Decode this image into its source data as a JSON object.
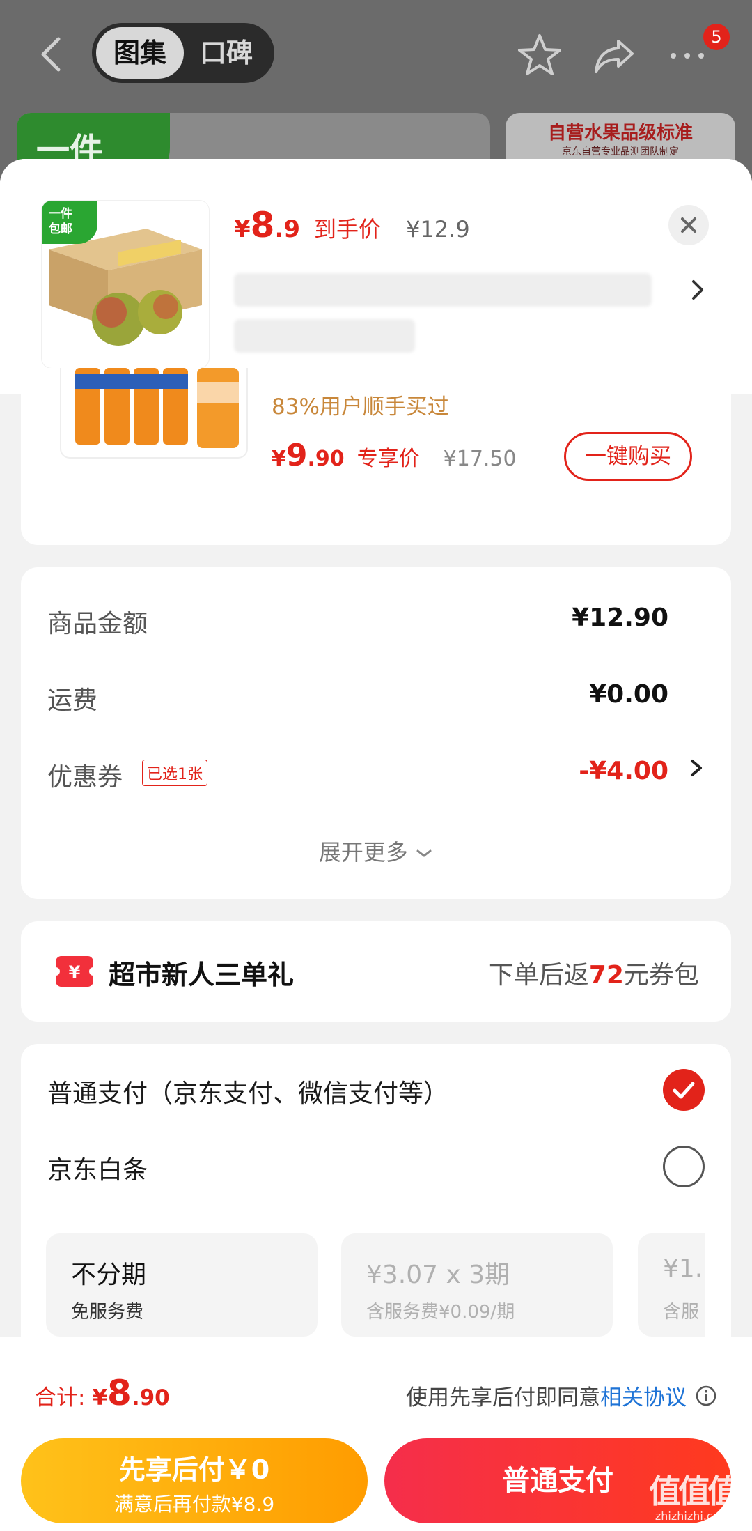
{
  "nav": {
    "tabs": [
      "图集",
      "口碑"
    ],
    "badge_count": "5"
  },
  "backdrop": {
    "promo_left": "一件",
    "promo_right_title": "自营水果品级标准",
    "promo_right_sub": "京东自营专业品测团队制定"
  },
  "product": {
    "thumb_tag": "一件\n包邮",
    "price_symbol": "¥",
    "price_int": "8",
    "price_dec": ".9",
    "price_label": "到手价",
    "original_price": "¥12.9"
  },
  "recommendation": {
    "buyers": "83%用户顺手买过",
    "price_symbol": "¥",
    "price_int": "9",
    "price_dec": ".90",
    "price_label": "专享价",
    "original_price": "¥17.50",
    "buy_button": "一键购买"
  },
  "totals": {
    "goods_label": "商品金额",
    "goods_value": "¥12.90",
    "shipping_label": "运费",
    "shipping_value": "¥0.00",
    "coupon_label": "优惠券",
    "coupon_tag": "已选1张",
    "coupon_value": "-¥4.00",
    "expand": "展开更多"
  },
  "gift": {
    "title": "超市新人三单礼",
    "desc_prefix": "下单后返",
    "desc_amount": "72",
    "desc_suffix": "元券包"
  },
  "payment": {
    "option_normal": "普通支付（京东支付、微信支付等）",
    "option_baitiao": "京东白条",
    "plans": [
      {
        "title": "不分期",
        "sub": "免服务费"
      },
      {
        "title": "¥3.07 x 3期",
        "sub": "含服务费¥0.09/期"
      },
      {
        "title": "¥1.",
        "sub": "含服"
      }
    ]
  },
  "bottom": {
    "total_label": "合计:",
    "total_symbol": "¥",
    "total_int": "8",
    "total_dec": ".90",
    "agree_text": "使用先享后付即同意",
    "agree_link": "相关协议",
    "btn_later_title": "先享后付￥0",
    "btn_later_sub": "满意后再付款¥8.9",
    "btn_pay": "普通支付"
  },
  "watermark": {
    "main": "值值值",
    "sub": "zhizhizhi.com"
  },
  "colors": {
    "accent": "#e2231a",
    "link": "#1e73d6",
    "later_btn": "#ffb000",
    "pay_btn": "#f52e4b"
  }
}
